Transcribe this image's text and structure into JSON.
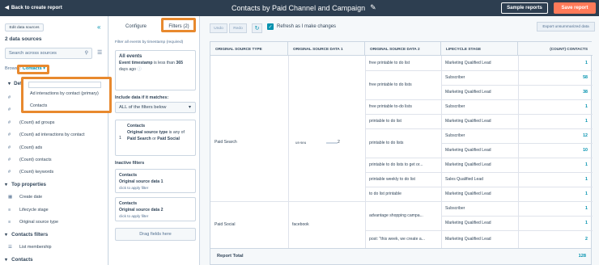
{
  "topbar": {
    "back_label": "Back to create report",
    "title": "Contacts by Paid Channel and Campaign",
    "sample_label": "Sample reports",
    "save_label": "Save report"
  },
  "left": {
    "edit_label": "Edit data sources",
    "ds_count": "2 data sources",
    "search_placeholder": "Search across sources",
    "browse_label": "Browse:",
    "browse_value": "Contacts",
    "section_default": "Def",
    "dropdown_options": [
      "Ad interactions by contact (primary)",
      "Contacts"
    ],
    "props_top": [
      "(Count) ad groups",
      "(Count) ad interactions by contact",
      "(Count) ads",
      "(Count) contacts",
      "(Count) keywords"
    ],
    "section_top": "Top properties",
    "props_top2": [
      "Create date",
      "Lifecycle stage",
      "Original source type"
    ],
    "section_filters": "Contacts filters",
    "props_filters": [
      "List membership"
    ],
    "section_contacts": "Contacts"
  },
  "mid": {
    "tab_configure": "Configure",
    "tab_filters": "Filters (2)",
    "note": "Filter all events by timestamp (required)",
    "all_events_title": "All events",
    "all_events_prop": "Event timestamp",
    "all_events_mid": "is less than",
    "all_events_val": "365",
    "all_events_tail": "days ago",
    "include_label": "Include data if it matches:",
    "select_value": "ALL of the filters below",
    "filter_num": "1",
    "filter_obj": "Contacts",
    "filter_prop": "Original source type",
    "filter_is": "is any of",
    "filter_val1": "Paid Search",
    "filter_or": "or",
    "filter_val2": "Paid Social",
    "inactive_label": "Inactive filters",
    "inactive1_obj": "Contacts",
    "inactive1_prop": "Original source data 1",
    "inactive1_hint": "click to apply filter",
    "inactive2_obj": "Contacts",
    "inactive2_prop": "Original source data 2",
    "inactive2_hint": "click to apply filter",
    "drag_label": "Drag fields here"
  },
  "toolbar": {
    "undo": "Undo",
    "redo": "Redo",
    "refresh_label": "Refresh as I make changes",
    "export_label": "Export unsummarized data"
  },
  "table": {
    "headers": [
      "ORIGINAL SOURCE TYPE",
      "ORIGINAL SOURCE DATA 1",
      "ORIGINAL SOURCE DATA 2",
      "LIFECYCLE STAGE",
      "(COUNT) CONTACTS"
    ],
    "source_paid_search": "Paid Search",
    "source_paid_social": "Paid Social",
    "data1_us": "us-seu",
    "data1_tail": "2",
    "data1_facebook": "facebook",
    "data2": [
      "free printable to do list",
      "free printable to do lists",
      "free printable to-do lists",
      "printable to do list",
      "printable to do lists",
      "printable to do lists to get or...",
      "printable weekly to do list",
      "to do list printable",
      "advantage shopping campa...",
      "post: \"this week, we create a..."
    ],
    "rows": [
      {
        "stage": "Marketing Qualified Lead",
        "count": "1"
      },
      {
        "stage": "Subscriber",
        "count": "58"
      },
      {
        "stage": "Marketing Qualified Lead",
        "count": "38"
      },
      {
        "stage": "Subscriber",
        "count": "1"
      },
      {
        "stage": "Marketing Qualified Lead",
        "count": "1"
      },
      {
        "stage": "Subscriber",
        "count": "12"
      },
      {
        "stage": "Marketing Qualified Lead",
        "count": "10"
      },
      {
        "stage": "Marketing Qualified Lead",
        "count": "1"
      },
      {
        "stage": "Sales Qualified Lead",
        "count": "1"
      },
      {
        "stage": "Marketing Qualified Lead",
        "count": "1"
      },
      {
        "stage": "Subscriber",
        "count": "1"
      },
      {
        "stage": "Marketing Qualified Lead",
        "count": "1"
      },
      {
        "stage": "Marketing Qualified Lead",
        "count": "2"
      },
      {
        "stage": "Subscriber",
        "count": "1"
      }
    ],
    "total_label": "Report Total",
    "total_value": "128"
  }
}
